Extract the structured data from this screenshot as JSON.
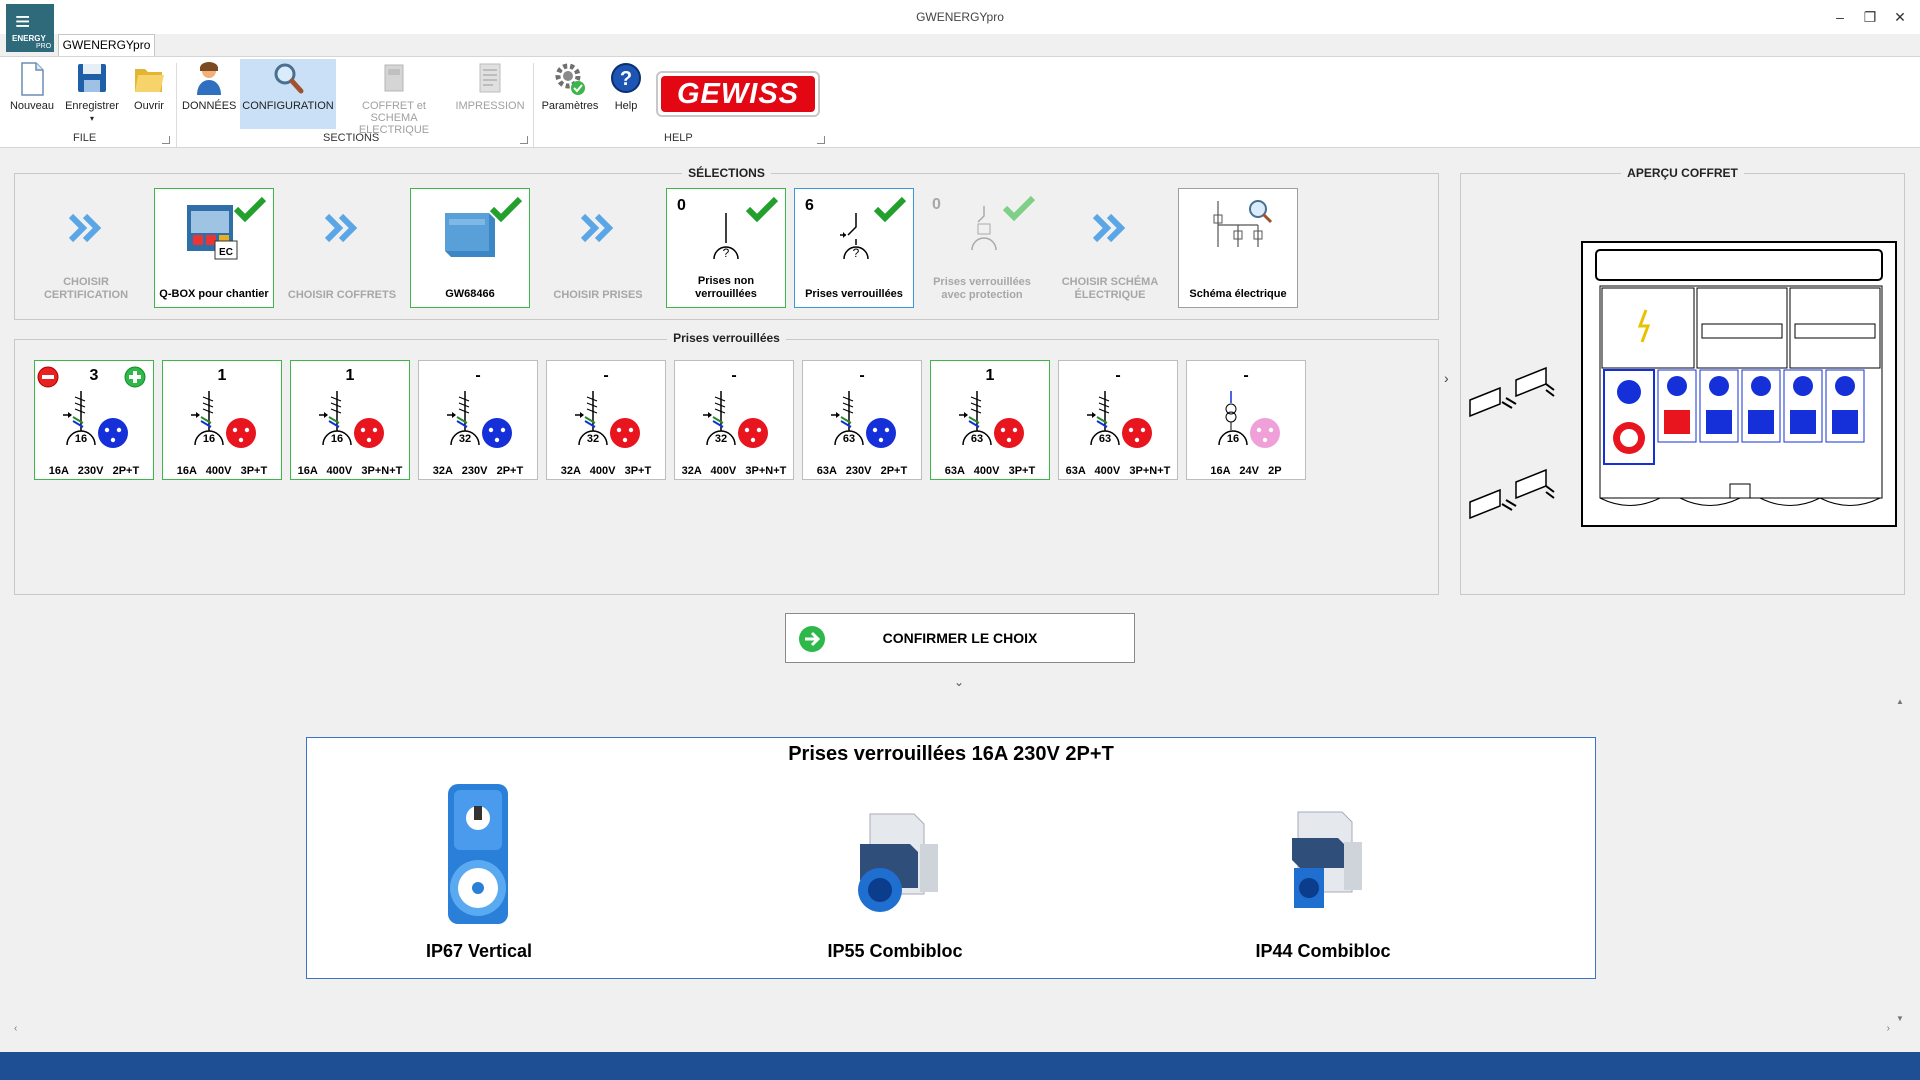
{
  "window": {
    "title": "GWENERGYpro",
    "tab_label": "GWENERGYpro",
    "logo_line1": "ENERGY",
    "logo_line2": "PRO"
  },
  "ribbon": {
    "file": {
      "label": "FILE",
      "buttons": [
        {
          "label": "Nouveau",
          "icon": "new-document-icon"
        },
        {
          "label": "Enregistrer",
          "icon": "save-icon"
        },
        {
          "label": "Ouvrir",
          "icon": "folder-open-icon"
        }
      ]
    },
    "sections": {
      "label": "SECTIONS",
      "buttons": [
        {
          "label": "DONNÉES",
          "icon": "user-icon"
        },
        {
          "label": "CONFIGURATION",
          "icon": "search-icon",
          "active": true
        },
        {
          "label": "COFFRET et SCHEMA ELECTRIQUE",
          "icon": "cabinet-icon",
          "disabled": true
        },
        {
          "label": "IMPRESSION",
          "icon": "print-icon",
          "disabled": true
        }
      ]
    },
    "help": {
      "label": "HELP",
      "buttons": [
        {
          "label": "Paramètres",
          "icon": "settings-icon"
        },
        {
          "label": "Help",
          "icon": "help-icon"
        }
      ],
      "brand": "GEWISS"
    }
  },
  "selections": {
    "title": "SÉLECTIONS",
    "cards": [
      {
        "label": "CHOISIR CERTIFICATION",
        "state": "pending"
      },
      {
        "label": "Q-BOX pour chantier",
        "state": "selected",
        "badge": "EC"
      },
      {
        "label": "CHOISIR COFFRETS",
        "state": "pending"
      },
      {
        "label": "GW68466",
        "state": "selected"
      },
      {
        "label": "CHOISIR PRISES",
        "state": "pending"
      },
      {
        "label": "Prises non verrouillées",
        "count": "0",
        "state": "selected"
      },
      {
        "label": "Prises verrouillées",
        "count": "6",
        "state": "current"
      },
      {
        "label": "Prises verrouillées avec protection",
        "count": "0",
        "state": "disabled"
      },
      {
        "label": "CHOISIR SCHÉMA ÉLECTRIQUE",
        "state": "pending"
      },
      {
        "label": "Schéma électrique",
        "state": "normal"
      }
    ]
  },
  "sockets": {
    "title": "Prises verrouillées",
    "items": [
      {
        "qty": "3",
        "amp": "16",
        "spec": "16A   230V   2P+T",
        "color": "#1530d8",
        "selected": true
      },
      {
        "qty": "1",
        "amp": "16",
        "spec": "16A   400V   3P+T",
        "color": "#e8141e",
        "selected": true
      },
      {
        "qty": "1",
        "amp": "16",
        "spec": "16A   400V   3P+N+T",
        "color": "#e8141e",
        "selected": true
      },
      {
        "qty": "-",
        "amp": "32",
        "spec": "32A   230V   2P+T",
        "color": "#1530d8",
        "selected": false
      },
      {
        "qty": "-",
        "amp": "32",
        "spec": "32A   400V   3P+T",
        "color": "#e8141e",
        "selected": false
      },
      {
        "qty": "-",
        "amp": "32",
        "spec": "32A   400V   3P+N+T",
        "color": "#e8141e",
        "selected": false
      },
      {
        "qty": "-",
        "amp": "63",
        "spec": "63A   230V   2P+T",
        "color": "#1530d8",
        "selected": false
      },
      {
        "qty": "1",
        "amp": "63",
        "spec": "63A   400V   3P+T",
        "color": "#e8141e",
        "selected": true
      },
      {
        "qty": "-",
        "amp": "63",
        "spec": "63A   400V   3P+N+T",
        "color": "#e8141e",
        "selected": false
      },
      {
        "qty": "-",
        "amp": "16",
        "spec": "16A   24V   2P",
        "color": "#f0a0d8",
        "selected": false
      }
    ]
  },
  "preview": {
    "title": "APERÇU COFFRET"
  },
  "confirm": {
    "label": "CONFIRMER LE CHOIX"
  },
  "product_panel": {
    "title": "Prises verrouillées   16A   230V   2P+T",
    "products": [
      {
        "name": "IP67 Vertical"
      },
      {
        "name": "IP55 Combibloc"
      },
      {
        "name": "IP44 Combibloc"
      }
    ]
  },
  "colors": {
    "accent_blue": "#1e4f94",
    "selected_green": "#3cb54a",
    "active_ribbon": "#c9e0f7",
    "brand_red": "#e30613"
  }
}
